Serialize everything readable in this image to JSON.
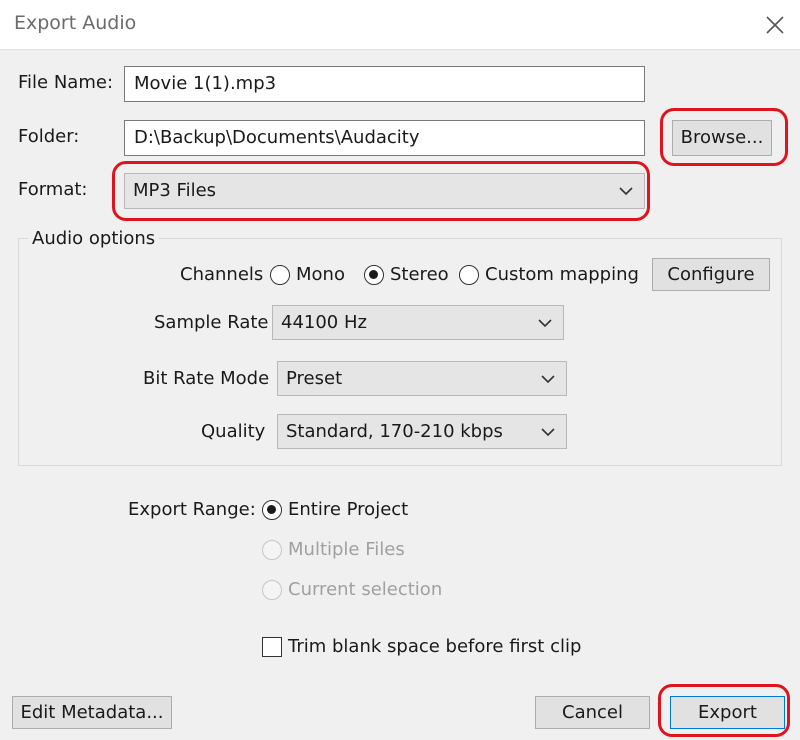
{
  "window": {
    "title": "Export Audio"
  },
  "file_name": {
    "label": "File Name:",
    "value": "Movie 1(1).mp3"
  },
  "folder": {
    "label": "Folder:",
    "value": "D:\\Backup\\Documents\\Audacity",
    "browse_label": "Browse..."
  },
  "format": {
    "label": "Format:",
    "value": "MP3 Files"
  },
  "audio_options": {
    "title": "Audio options",
    "channels": {
      "label": "Channels",
      "options": [
        {
          "label": "Mono",
          "selected": false
        },
        {
          "label": "Stereo",
          "selected": true
        },
        {
          "label": "Custom mapping",
          "selected": false
        }
      ],
      "configure_label": "Configure"
    },
    "sample_rate": {
      "label": "Sample Rate",
      "value": "44100 Hz"
    },
    "bit_rate_mode": {
      "label": "Bit Rate Mode",
      "value": "Preset"
    },
    "quality": {
      "label": "Quality",
      "value": "Standard, 170-210 kbps"
    }
  },
  "export_range": {
    "label": "Export Range:",
    "options": [
      {
        "label": "Entire Project",
        "selected": true,
        "enabled": true
      },
      {
        "label": "Multiple Files",
        "selected": false,
        "enabled": false
      },
      {
        "label": "Current selection",
        "selected": false,
        "enabled": false
      }
    ]
  },
  "trim": {
    "label": "Trim blank space before first clip",
    "checked": false
  },
  "buttons": {
    "edit_metadata": "Edit Metadata...",
    "cancel": "Cancel",
    "export": "Export"
  },
  "colors": {
    "highlight": "#e0141e",
    "background": "#f0f0f0",
    "button": "#e1e1e1"
  }
}
